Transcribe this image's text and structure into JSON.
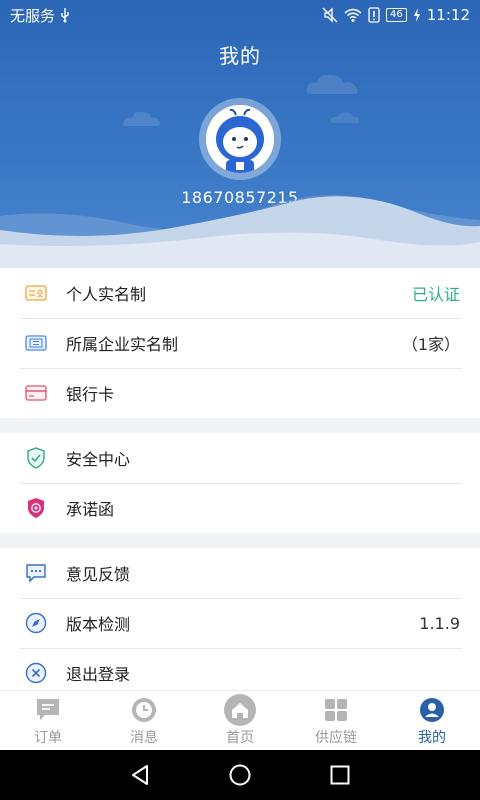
{
  "status_bar": {
    "carrier": "无服务",
    "battery": "46",
    "time": "11:12"
  },
  "header": {
    "title": "我的",
    "phone": "18670857215"
  },
  "groups": [
    [
      {
        "label": "个人实名制",
        "value": "已认证",
        "icon": "id-card-icon"
      },
      {
        "label": "所属企业实名制",
        "value": "（1家）",
        "icon": "enterprise-card-icon"
      },
      {
        "label": "银行卡",
        "value": "",
        "icon": "bank-card-icon"
      }
    ],
    [
      {
        "label": "安全中心",
        "value": "",
        "icon": "shield-check-icon"
      },
      {
        "label": "承诺函",
        "value": "",
        "icon": "promise-badge-icon"
      }
    ],
    [
      {
        "label": "意见反馈",
        "value": "",
        "icon": "feedback-chat-icon"
      },
      {
        "label": "版本检测",
        "value": "1.1.9",
        "icon": "compass-icon"
      },
      {
        "label": "退出登录",
        "value": "",
        "icon": "logout-x-icon"
      }
    ]
  ],
  "tabs": [
    {
      "label": "订单",
      "icon": "order-chat-icon",
      "active": false
    },
    {
      "label": "消息",
      "icon": "clock-icon",
      "active": false
    },
    {
      "label": "首页",
      "icon": "home-icon",
      "active": false
    },
    {
      "label": "供应链",
      "icon": "grid-icon",
      "active": false
    },
    {
      "label": "我的",
      "icon": "user-icon",
      "active": true
    }
  ],
  "colors": {
    "header": "#2c66b6",
    "verified_green": "#30b083",
    "active_tab": "#2a60a8",
    "inactive_tab": "#999999"
  }
}
